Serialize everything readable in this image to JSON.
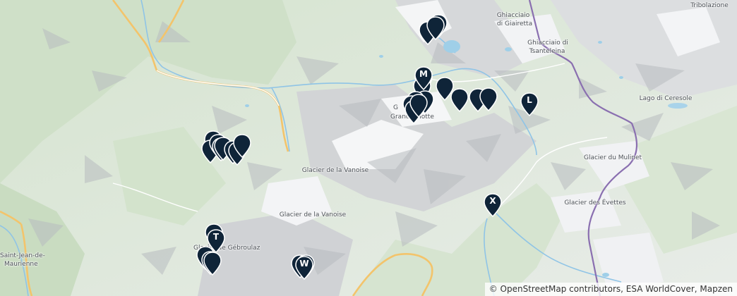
{
  "map": {
    "labels": {
      "ghiacciaio_giairetta_1": "Ghiacciaio",
      "ghiacciaio_giairetta_2": "di Giairetta",
      "ghiacciaio_tsanteleina_1": "Ghiacciaio di",
      "ghiacciaio_tsanteleina_2": "Tsanteleina",
      "tribolazione": "Tribolazione",
      "lago_ceresole": "Lago di Ceresole",
      "grande_motte_1": "G",
      "grande_motte_2": "Grande Motte",
      "glacier_vanoise_1": "Glacier de la Vanoise",
      "glacier_vanoise_2": "Glacier de la Vanoise",
      "glacier_mulinet": "Glacier du Mulinet",
      "glacier_evettes": "Glacier des Évettes",
      "gebroulaz": "Glacier de Gébroulaz",
      "st_jean_1": "Saint-Jean-de-",
      "st_jean_2": "Maurienne"
    },
    "marker_letters": {
      "m": "M",
      "l": "L",
      "x": "X",
      "t": "T",
      "w": "W"
    },
    "marker_color": "#0f2438",
    "attribution": "© OpenStreetMap contributors, ESA WorldCover, Mapzen"
  }
}
